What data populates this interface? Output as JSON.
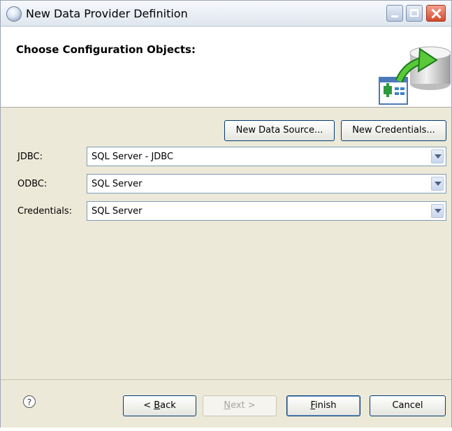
{
  "window": {
    "title": "New Data Provider Definition"
  },
  "header": {
    "title": "Choose Configuration Objects:"
  },
  "actions": {
    "new_data_source": "New Data Source...",
    "new_credentials": "New Credentials..."
  },
  "fields": [
    {
      "label": "JDBC:",
      "value": "SQL Server - JDBC"
    },
    {
      "label": "ODBC:",
      "value": "SQL Server"
    },
    {
      "label": "Credentials:",
      "value": "SQL Server"
    }
  ],
  "footer": {
    "help": "?",
    "back_prefix": "< ",
    "back_mnemonic": "B",
    "back_rest": "ack",
    "next_mnemonic": "N",
    "next_rest": "ext >",
    "finish_mnemonic": "F",
    "finish_rest": "inish",
    "cancel": "Cancel"
  },
  "icons": {
    "title": "data-provider-icon",
    "wizard": "database-cylinder-icon",
    "arrow": "green-arrow-icon",
    "table": "add-table-icon"
  }
}
